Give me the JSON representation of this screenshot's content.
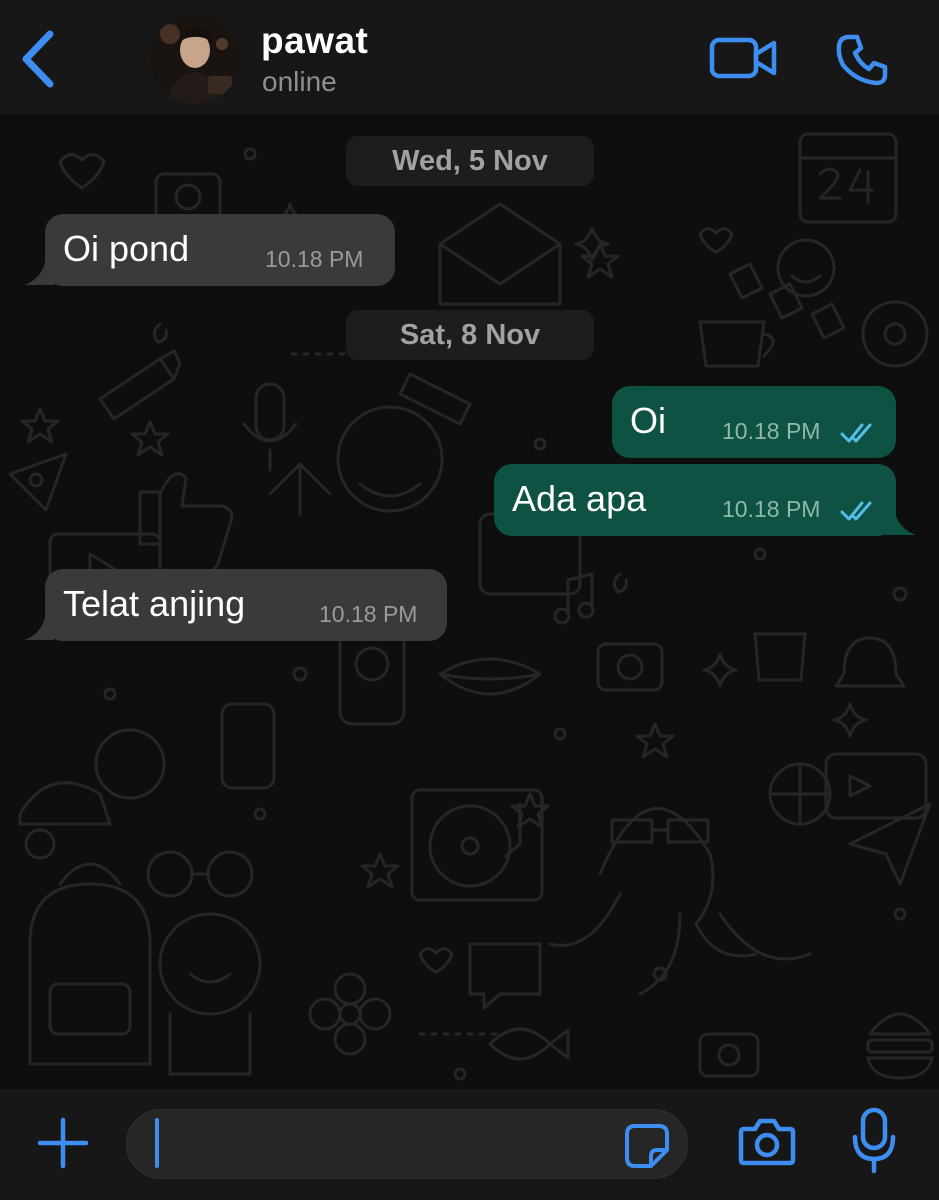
{
  "header": {
    "contact_name": "pawat",
    "contact_status": "online"
  },
  "messages": [
    {
      "type": "date",
      "label": "Wed, 5 Nov"
    },
    {
      "type": "incoming",
      "text": "Oi pond",
      "time": "10.18 PM"
    },
    {
      "type": "date",
      "label": "Sat, 8 Nov"
    },
    {
      "type": "outgoing",
      "text": "Oi",
      "time": "10.18 PM",
      "status": "read"
    },
    {
      "type": "outgoing",
      "text": "Ada apa",
      "time": "10.18 PM",
      "status": "read"
    },
    {
      "type": "incoming",
      "text": "Telat anjing",
      "time": "10.18 PM"
    }
  ],
  "composer": {
    "value": "",
    "placeholder": ""
  },
  "icons": {
    "back": "chevron-left-icon",
    "video_call": "video-camera-icon",
    "voice_call": "phone-icon",
    "attach": "plus-icon",
    "sticker": "sticker-icon",
    "camera": "camera-icon",
    "microphone": "microphone-icon",
    "read_receipt": "double-check-icon"
  },
  "colors": {
    "accent": "#3d8ef0",
    "incoming_bubble": "#3a3a3c",
    "outgoing_bubble": "#0d5242",
    "read_receipt": "#53bdeb",
    "header_background": "#171717"
  }
}
